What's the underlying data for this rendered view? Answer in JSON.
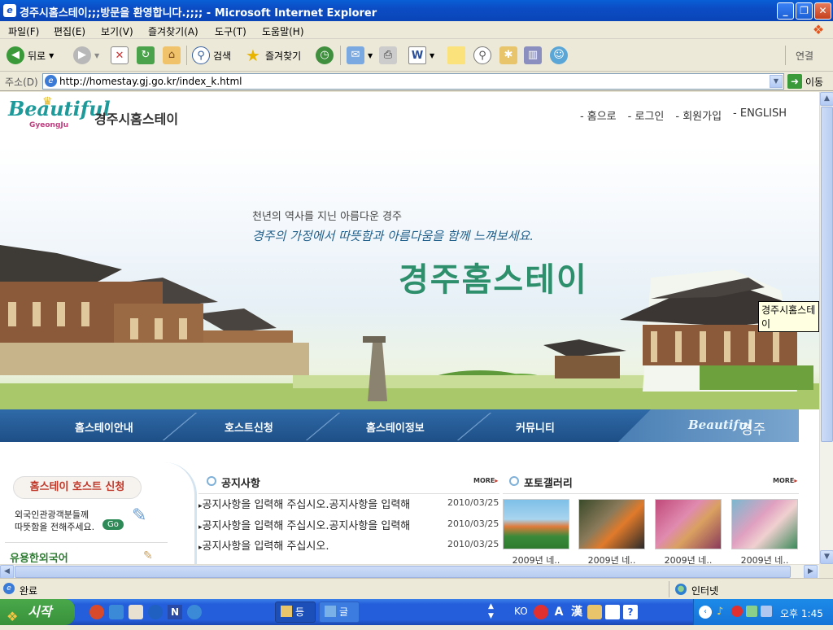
{
  "window": {
    "title": "경주시홈스테이;;;방문을 환영합니다.;;;; - Microsoft Internet Explorer",
    "icon": "ie-icon"
  },
  "menu": [
    "파일(F)",
    "편집(E)",
    "보기(V)",
    "즐겨찾기(A)",
    "도구(T)",
    "도움말(H)"
  ],
  "toolbar": {
    "back": "뒤로",
    "search": "검색",
    "favorites": "즐겨찾기",
    "links": "연결"
  },
  "address": {
    "label": "주소(D)",
    "url": "http://homestay.gj.go.kr/index_k.html",
    "go": "이동"
  },
  "site": {
    "logo_en": "Beautiful",
    "logo_sub": "GyeongJu",
    "logo_ko": "경주시홈스테이",
    "topnav": [
      "- 홈으로",
      "- 로그인",
      "- 회원가입",
      "- ENGLISH"
    ],
    "hero": {
      "line1": "천년의 역사를 지닌 아름다운 경주",
      "line2": "경주의 가정에서 따뜻함과 아름다움을 함께 느껴보세요.",
      "title": "경주홈스테이"
    },
    "tooltip": "경주시홈스테이",
    "nav": [
      "홈스테이안내",
      "호스트신청",
      "홈스테이정보",
      "커뮤니티"
    ],
    "nav_logo": {
      "en": "Beautiful",
      "ko": "경주"
    },
    "host_button": "홈스테이 호스트 신청",
    "host_text1": "외국인관광객분들께",
    "host_text2": "따뜻함을 전해주세요.",
    "go_label": "Go",
    "useful_korean": "유용한외국어",
    "notice": {
      "title": "공지사항",
      "more": "MORE",
      "items": [
        {
          "text": "공지사항을 입력해 주십시오.공지사항을 입력해",
          "date": "2010/03/25"
        },
        {
          "text": "공지사항을 입력해 주십시오.공지사항을 입력해",
          "date": "2010/03/25"
        },
        {
          "text": "공지사항을 입력해 주십시오.",
          "date": "2010/03/25"
        }
      ]
    },
    "gallery": {
      "title": "포토갤러리",
      "more": "MORE",
      "items": [
        {
          "caption": "2009년 네.."
        },
        {
          "caption": "2009년 네.."
        },
        {
          "caption": "2009년 네.."
        },
        {
          "caption": "2009년 네.."
        }
      ]
    }
  },
  "status": {
    "text": "완료",
    "zone": "인터넷"
  },
  "taskbar": {
    "start": "시작",
    "task1": "등",
    "task2": "글",
    "lang": "KO",
    "clock": "오후 1:45"
  }
}
